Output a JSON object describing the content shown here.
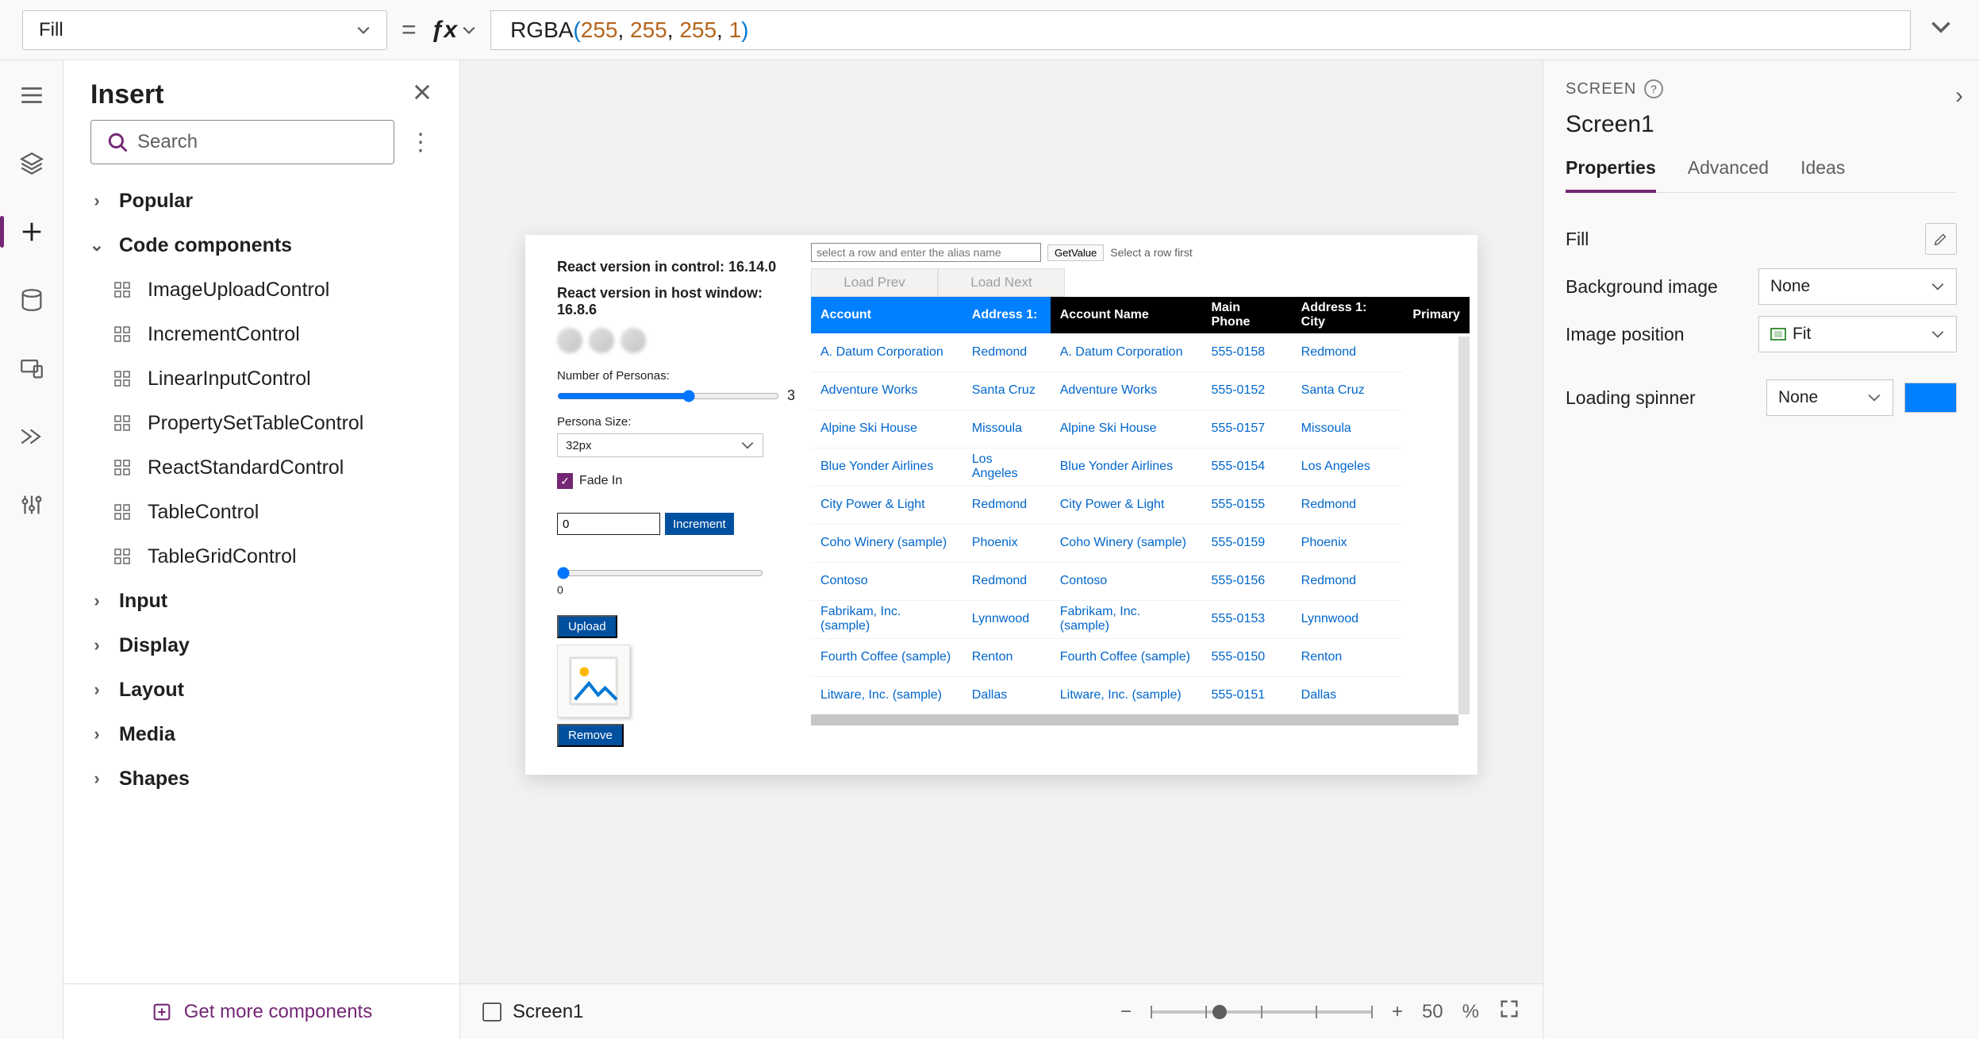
{
  "formula_bar": {
    "property": "Fill",
    "fn": "RGBA",
    "args": [
      "255",
      "255",
      "255",
      "1"
    ]
  },
  "insert_panel": {
    "title": "Insert",
    "search_placeholder": "Search",
    "categories": {
      "popular": "Popular",
      "code_components": "Code components",
      "input": "Input",
      "display": "Display",
      "layout": "Layout",
      "media": "Media",
      "shapes": "Shapes"
    },
    "code_components_items": [
      "ImageUploadControl",
      "IncrementControl",
      "LinearInputControl",
      "PropertySetTableControl",
      "ReactStandardControl",
      "TableControl",
      "TableGridControl"
    ],
    "get_more": "Get more components"
  },
  "canvas": {
    "react_control_prefix": "React version in control: ",
    "react_control_value": "16.14.0",
    "react_host_prefix": "React version in host window: ",
    "react_host_value": "16.8.6",
    "num_personas_label": "Number of Personas:",
    "num_personas_value": "3",
    "persona_size_label": "Persona Size:",
    "persona_size_value": "32px",
    "fade_in_label": "Fade In",
    "increment_value": "0",
    "increment_btn": "Increment",
    "slider_value": "0",
    "upload_btn": "Upload",
    "remove_btn": "Remove",
    "alias_placeholder": "select a row and enter the alias name",
    "getvalue_btn": "GetValue",
    "select_row_hint": "Select a row first",
    "load_prev": "Load Prev",
    "load_next": "Load Next",
    "table_headers": [
      "Account",
      "Address 1:",
      "Account Name",
      "Main Phone",
      "Address 1: City",
      "Primary"
    ],
    "table_rows": [
      [
        "A. Datum Corporation",
        "Redmond",
        "A. Datum Corporation",
        "555-0158",
        "Redmond"
      ],
      [
        "Adventure Works",
        "Santa Cruz",
        "Adventure Works",
        "555-0152",
        "Santa Cruz"
      ],
      [
        "Alpine Ski House",
        "Missoula",
        "Alpine Ski House",
        "555-0157",
        "Missoula"
      ],
      [
        "Blue Yonder Airlines",
        "Los Angeles",
        "Blue Yonder Airlines",
        "555-0154",
        "Los Angeles"
      ],
      [
        "City Power & Light",
        "Redmond",
        "City Power & Light",
        "555-0155",
        "Redmond"
      ],
      [
        "Coho Winery (sample)",
        "Phoenix",
        "Coho Winery (sample)",
        "555-0159",
        "Phoenix"
      ],
      [
        "Contoso",
        "Redmond",
        "Contoso",
        "555-0156",
        "Redmond"
      ],
      [
        "Fabrikam, Inc. (sample)",
        "Lynnwood",
        "Fabrikam, Inc. (sample)",
        "555-0153",
        "Lynnwood"
      ],
      [
        "Fourth Coffee (sample)",
        "Renton",
        "Fourth Coffee (sample)",
        "555-0150",
        "Renton"
      ],
      [
        "Litware, Inc. (sample)",
        "Dallas",
        "Litware, Inc. (sample)",
        "555-0151",
        "Dallas"
      ]
    ]
  },
  "footer": {
    "screen_name": "Screen1",
    "zoom_pct": "50",
    "zoom_unit": "%"
  },
  "props": {
    "kicker": "SCREEN",
    "title": "Screen1",
    "tabs": {
      "properties": "Properties",
      "advanced": "Advanced",
      "ideas": "Ideas"
    },
    "fill_label": "Fill",
    "bg_image_label": "Background image",
    "bg_image_value": "None",
    "img_pos_label": "Image position",
    "img_pos_value": "Fit",
    "spinner_label": "Loading spinner",
    "spinner_value": "None"
  }
}
